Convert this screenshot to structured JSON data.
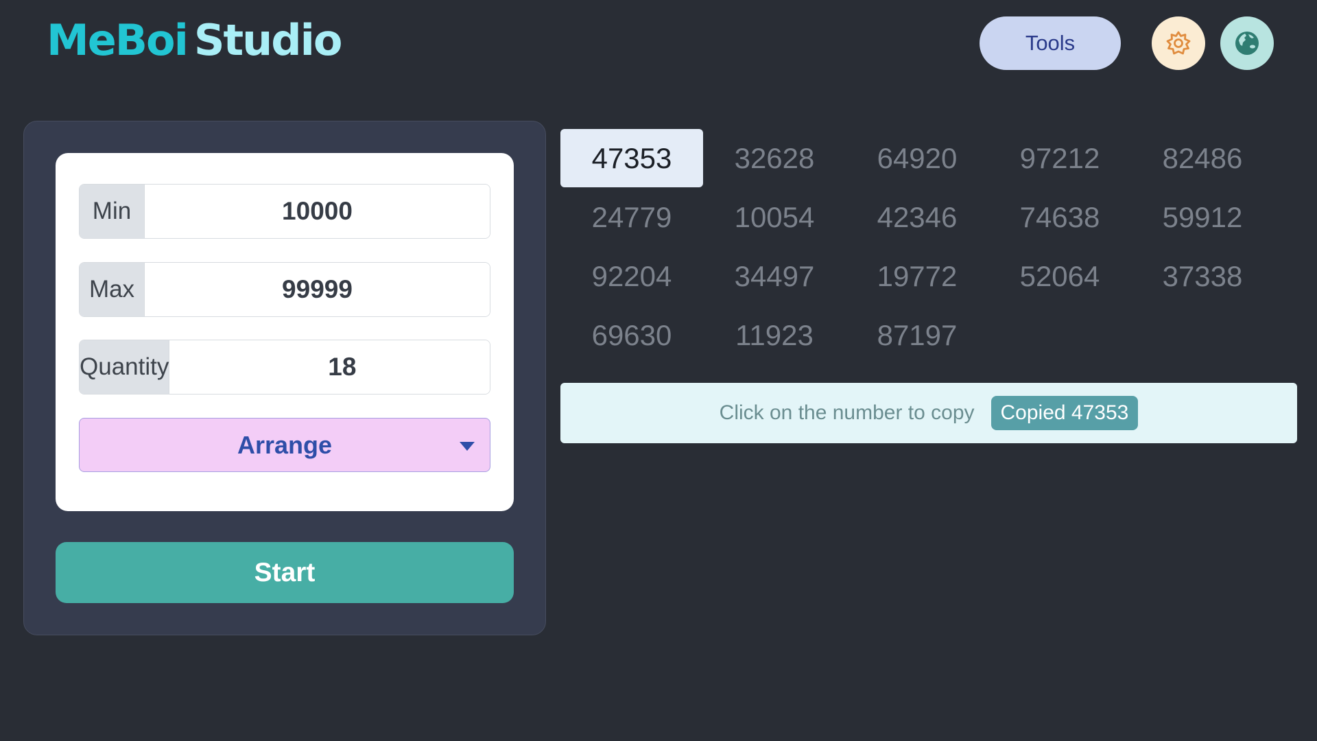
{
  "header": {
    "logo_part1": "MeBoi",
    "logo_part2": "Studio",
    "tools_label": "Tools",
    "settings_icon": "gear-icon",
    "language_icon": "globe-icon"
  },
  "form": {
    "min_label": "Min",
    "min_value": "10000",
    "max_label": "Max",
    "max_value": "99999",
    "quantity_label": "Quantity",
    "quantity_value": "18",
    "arrange_selected": "Arrange",
    "start_label": "Start"
  },
  "results": {
    "numbers": [
      "47353",
      "32628",
      "64920",
      "97212",
      "82486",
      "24779",
      "10054",
      "42346",
      "74638",
      "59912",
      "92204",
      "34497",
      "19772",
      "52064",
      "37338",
      "69630",
      "11923",
      "87197"
    ],
    "selected_index": 0
  },
  "info": {
    "hint": "Click on the number to copy",
    "copied_badge": "Copied 47353"
  },
  "colors": {
    "background": "#292d35",
    "accent_teal": "#47aea5",
    "logo_primary": "#22c5d3",
    "logo_secondary": "#a9eef6",
    "arrange_bg": "#f3cdf7",
    "badge": "#579fa7"
  }
}
